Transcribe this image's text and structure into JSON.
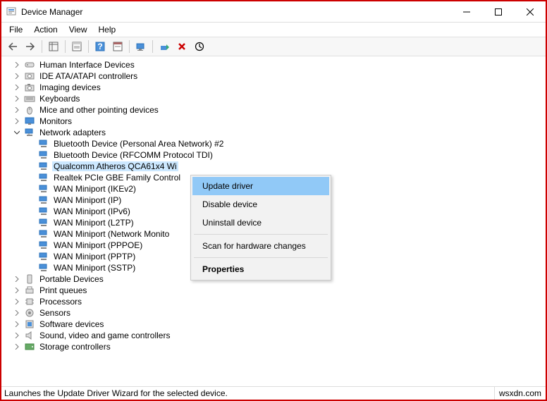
{
  "window": {
    "title": "Device Manager"
  },
  "menu": {
    "file": "File",
    "action": "Action",
    "view": "View",
    "help": "Help"
  },
  "tree": {
    "hid": "Human Interface Devices",
    "ide": "IDE ATA/ATAPI controllers",
    "imaging": "Imaging devices",
    "keyboards": "Keyboards",
    "mice": "Mice and other pointing devices",
    "monitors": "Monitors",
    "network": "Network adapters",
    "portable": "Portable Devices",
    "printqueues": "Print queues",
    "processors": "Processors",
    "sensors": "Sensors",
    "software": "Software devices",
    "sound": "Sound, video and game controllers",
    "storage": "Storage controllers",
    "net": {
      "bt_pan": "Bluetooth Device (Personal Area Network) #2",
      "bt_rfcomm": "Bluetooth Device (RFCOMM Protocol TDI)",
      "qualcomm": "Qualcomm Atheros QCA61x4 Wi",
      "realtek": "Realtek PCIe GBE Family Control",
      "wan_ikev2": "WAN Miniport (IKEv2)",
      "wan_ip": "WAN Miniport (IP)",
      "wan_ipv6": "WAN Miniport (IPv6)",
      "wan_l2tp": "WAN Miniport (L2TP)",
      "wan_netmon": "WAN Miniport (Network Monito",
      "wan_pppoe": "WAN Miniport (PPPOE)",
      "wan_pptp": "WAN Miniport (PPTP)",
      "wan_sstp": "WAN Miniport (SSTP)"
    }
  },
  "context": {
    "update": "Update driver",
    "disable": "Disable device",
    "uninstall": "Uninstall device",
    "scan": "Scan for hardware changes",
    "properties": "Properties"
  },
  "status": {
    "text": "Launches the Update Driver Wizard for the selected device.",
    "right": "wsxdn.com"
  }
}
